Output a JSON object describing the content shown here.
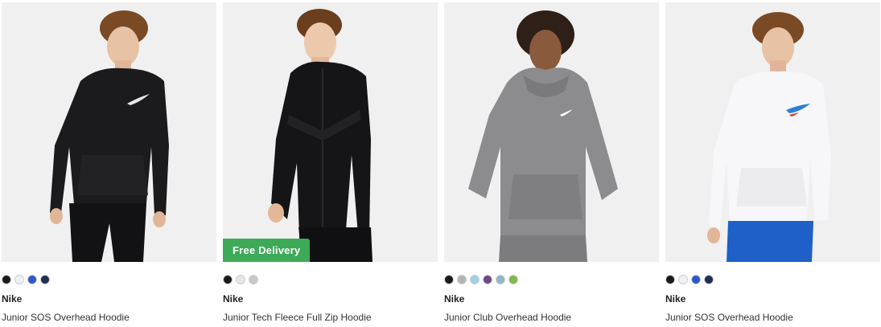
{
  "products": [
    {
      "brand": "Nike",
      "name": "Junior SOS Overhead Hoodie",
      "badge": "",
      "image_icon": "boy-black-hoodie-image",
      "hoodie_color": "#1b1b1d",
      "swatches": [
        "#1a1a1a",
        "#eef0f5",
        "#2a5bc4",
        "#1f2e52"
      ]
    },
    {
      "brand": "Nike",
      "name": "Junior Tech Fleece Full Zip Hoodie",
      "badge": "Free Delivery",
      "image_icon": "boy-black-zip-hoodie-image",
      "hoodie_color": "#151517",
      "swatches": [
        "#1a1a1a",
        "#e6e7ec",
        "#c8c8c8"
      ]
    },
    {
      "brand": "Nike",
      "name": "Junior Club Overhead Hoodie",
      "badge": "",
      "image_icon": "boy-grey-hoodie-image",
      "hoodie_color": "#8a8a8c",
      "swatches": [
        "#1a1a1a",
        "#b3b3b3",
        "#9fd0ea",
        "#6b4a86",
        "#8fb7cc",
        "#7fb84b"
      ]
    },
    {
      "brand": "Nike",
      "name": "Junior SOS Overhead Hoodie",
      "badge": "",
      "image_icon": "boy-white-hoodie-image",
      "hoodie_color": "#f7f7f9",
      "swatches": [
        "#1a1a1a",
        "#eef0f5",
        "#2a5bc4",
        "#1f2e52"
      ]
    }
  ]
}
